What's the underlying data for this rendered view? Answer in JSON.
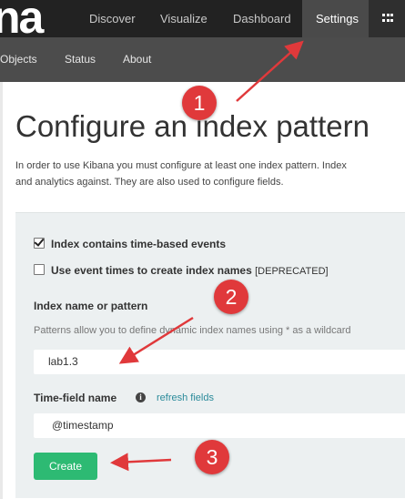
{
  "app": {
    "logo_text": "na"
  },
  "topnav": {
    "items": [
      {
        "label": "Discover"
      },
      {
        "label": "Visualize"
      },
      {
        "label": "Dashboard"
      },
      {
        "label": "Settings"
      }
    ],
    "apps_icon": "grid-icon"
  },
  "subnav": {
    "items": [
      {
        "label": "Objects"
      },
      {
        "label": "Status"
      },
      {
        "label": "About"
      }
    ]
  },
  "page": {
    "title": "Configure an index pattern",
    "intro_line1": "In order to use Kibana you must configure at least one index pattern. Index",
    "intro_line2": "and analytics against. They are also used to configure fields."
  },
  "form": {
    "time_based_label": "Index contains time-based events",
    "time_based_checked": true,
    "event_times_label": "Use event times to create index names",
    "event_times_suffix": "[DEPRECATED]",
    "event_times_checked": false,
    "index_label": "Index name or pattern",
    "index_help": "Patterns allow you to define dynamic index names using * as a wildcard",
    "index_value": "lab1.3",
    "time_field_label": "Time-field name",
    "refresh_link": "refresh fields",
    "time_field_value": "@timestamp",
    "create_label": "Create"
  },
  "annotations": {
    "markers": [
      "1",
      "2",
      "3"
    ],
    "color": "#e0393b"
  },
  "colors": {
    "topbar": "#222222",
    "subnav": "#4c4c4c",
    "panel": "#ecf0f1",
    "create_button": "#2dba73",
    "link": "#2a8a9a"
  }
}
